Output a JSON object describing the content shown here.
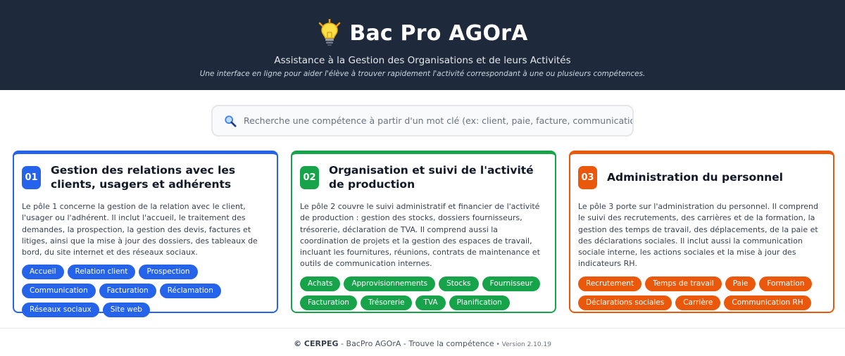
{
  "header": {
    "title": "Bac Pro AGOrA",
    "subtitle": "Assistance à la Gestion des Organisations et de leurs Activités",
    "tagline": "Une interface en ligne pour aider l'élève à trouver rapidement l'activité correspondant à une ou plusieurs compétences."
  },
  "search": {
    "placeholder": "Recherche une compétence à partir d'un mot clé (ex: client, paie, facture, communication...)",
    "value": ""
  },
  "poles": [
    {
      "number": "01",
      "title": "Gestion des relations avec les clients, usagers et adhérents",
      "description": "Le pôle 1 concerne la gestion de la relation avec le client, l'usager ou l'adhérent. Il inclut l'accueil, le traitement des demandes, la prospection, la gestion des devis, factures et litiges, ainsi que la mise à jour des dossiers, des tableaux de bord, du site internet et des réseaux sociaux.",
      "color": "#2563eb",
      "tags": [
        "Accueil",
        "Relation client",
        "Prospection",
        "Communication",
        "Facturation",
        "Réclamation",
        "Réseaux sociaux",
        "Site web"
      ]
    },
    {
      "number": "02",
      "title": "Organisation et suivi de l'activité de production",
      "description": "Le pôle 2 couvre le suivi administratif et financier de l'activité de production : gestion des stocks, dossiers fournisseurs, trésorerie, déclaration de TVA. Il comprend aussi la coordination de projets et la gestion des espaces de travail, incluant les fournitures, réunions, contrats de maintenance et outils de communication internes.",
      "color": "#16a34a",
      "tags": [
        "Achats",
        "Approvisionnements",
        "Stocks",
        "Fournisseur",
        "Facturation",
        "Trésorerie",
        "TVA",
        "Planification"
      ]
    },
    {
      "number": "03",
      "title": "Administration du personnel",
      "description": "Le pôle 3 porte sur l'administration du personnel. Il comprend le suivi des recrutements, des carrières et de la formation, la gestion des temps de travail, des déplacements, de la paie et des déclarations sociales. Il inclut aussi la communication sociale interne, les actions sociales et la mise à jour des indicateurs RH.",
      "color": "#ea580c",
      "tags": [
        "Recrutement",
        "Temps de travail",
        "Paie",
        "Formation",
        "Déclarations sociales",
        "Carrière",
        "Communication RH"
      ]
    }
  ],
  "footer": {
    "brand": "© CERPEG",
    "text": " - BacPro AGOrA - Trouve la compétence",
    "version": " • Version 2.10.19"
  },
  "icons": {
    "logo": "lightbulb-icon",
    "search": "magnifier-icon"
  }
}
